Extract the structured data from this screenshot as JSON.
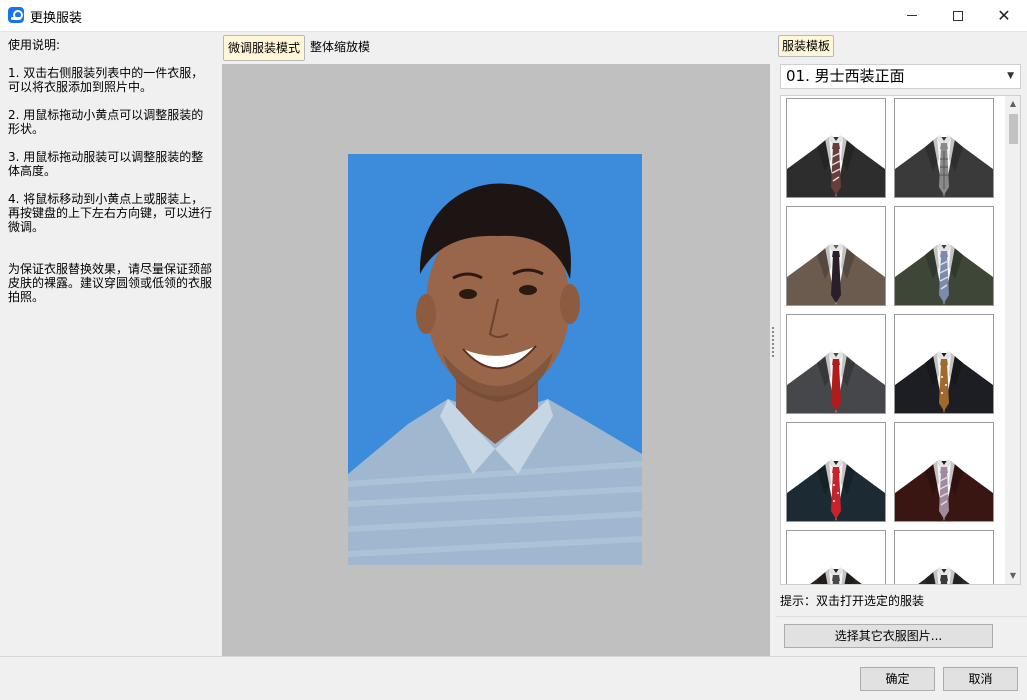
{
  "window": {
    "title": "更换服装",
    "icon": "app-icon",
    "controls": [
      "minimize-icon",
      "maximize-icon",
      "close-icon"
    ]
  },
  "help": {
    "title": "使用说明:",
    "items": [
      "1. 双击右侧服装列表中的一件衣服，\n可以将衣服添加到照片中。",
      "2. 用鼠标拖动小黄点可以调整服装的\n形状。",
      "3. 用鼠标拖动服装可以调整服装的整\n体高度。",
      "4. 将鼠标移动到小黄点上或服装上，\n再按键盘的上下左右方向键，可以进行\n微调。"
    ],
    "note": "为保证衣服替换效果，请尽量保证颈部\n皮肤的裸露。建议穿圆领或低领的衣服\n拍照。"
  },
  "center": {
    "tabs": [
      {
        "label": "微调服装模式",
        "active": true
      },
      {
        "label": "整体缩放模式",
        "active": false
      }
    ],
    "photo_background": "#3d8bdb"
  },
  "right": {
    "tab_label": "服装模板",
    "selected_template": "01. 男士西装正面",
    "thumbnails": [
      {
        "name": "suit-thumb-1",
        "suit": "#2d2d2d",
        "tie": "#6a3d3d",
        "tie_pattern": "stripe"
      },
      {
        "name": "suit-thumb-2",
        "suit": "#3a3a3a",
        "tie": "#8a8a8a",
        "tie_pattern": "check"
      },
      {
        "name": "suit-thumb-3",
        "suit": "#6b5a4e",
        "tie": "#2a1e2a",
        "tie_pattern": "plain"
      },
      {
        "name": "suit-thumb-4",
        "suit": "#3e4638",
        "tie": "#7c8ab0",
        "tie_pattern": "stripe"
      },
      {
        "name": "suit-thumb-5",
        "suit": "#45474a",
        "tie": "#b01c1c",
        "tie_pattern": "plain"
      },
      {
        "name": "suit-thumb-6",
        "suit": "#1d1e24",
        "tie": "#a06a2e",
        "tie_pattern": "dots"
      },
      {
        "name": "suit-thumb-7",
        "suit": "#1c2a33",
        "tie": "#c8232b",
        "tie_pattern": "dots"
      },
      {
        "name": "suit-thumb-8",
        "suit": "#3a1612",
        "tie": "#a08aa0",
        "tie_pattern": "stripe"
      },
      {
        "name": "suit-thumb-9",
        "suit": "#2a2320",
        "tie": "#4a4a4a",
        "tie_pattern": "plain"
      },
      {
        "name": "suit-thumb-10",
        "suit": "#2a2a2a",
        "tie": "#3a3a3a",
        "tie_pattern": "plain"
      }
    ],
    "hint": "提示：双击打开选定的服装",
    "choose_button": "选择其它衣服图片..."
  },
  "footer": {
    "ok": "确定",
    "cancel": "取消"
  }
}
